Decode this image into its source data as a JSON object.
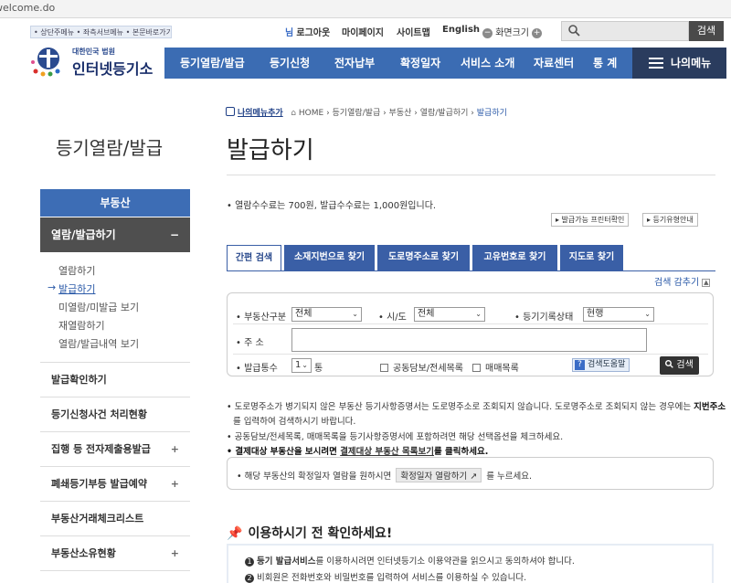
{
  "browser": {
    "title_fragment": "welcome.do"
  },
  "skip_links": "• 상단주메뉴 • 좌측서브메뉴 • 본문바로가기",
  "util": {
    "logout": "로그아웃",
    "mypage": "마이페이지",
    "sitemap": "사이트맵",
    "english": "English",
    "screen_size": "화면크기",
    "minus": "−",
    "plus": "+",
    "search_button": "검색"
  },
  "logo": {
    "sub": "대한민국 법원",
    "main": "인터넷등기소"
  },
  "gnb": [
    "등기열람/발급",
    "등기신청",
    "전자납부",
    "확정일자",
    "서비스 소개",
    "자료센터",
    "통 계"
  ],
  "my_menu": "나의메뉴",
  "sidebar": {
    "title": "등기열람/발급",
    "category": "부동산",
    "active": "열람/발급하기",
    "active_toggle": "−",
    "sub_items": [
      "열람하기",
      "발급하기",
      "미열람/미발급 보기",
      "재열람하기",
      "열람/발급내역 보기"
    ],
    "sub_active_marker": "→",
    "items": [
      {
        "label": "발급확인하기",
        "toggle": ""
      },
      {
        "label": "등기신청사건 처리현황",
        "toggle": ""
      },
      {
        "label": "집행 등 전자제출용발급",
        "toggle": "+"
      },
      {
        "label": "폐쇄등기부등 발급예약",
        "toggle": "+"
      },
      {
        "label": "부동산거래체크리스트",
        "toggle": ""
      },
      {
        "label": "부동산소유현황",
        "toggle": "+"
      }
    ]
  },
  "breadcrumb": {
    "add": "나의메뉴추가",
    "home": "HOME",
    "path": "› 등기열람/발급 › 부동산 › 열람/발급하기 ›",
    "current": "발급하기"
  },
  "page_title": "발급하기",
  "fee_note": "• 열람수수료는 700원, 발급수수료는 1,000원입니다.",
  "small_buttons": [
    "▸ 발급가능 프린터확인",
    "▸ 등기유형안내"
  ],
  "tabs": [
    "간편 검색",
    "소재지번으로 찾기",
    "도로명주소로 찾기",
    "고유번호로 찾기",
    "지도로 찾기"
  ],
  "collapse_search": "검색 감추기",
  "collapse_icon": "▲",
  "form": {
    "type_label": "• 부동산구분",
    "type_value": "전체",
    "city_label": "• 시/도",
    "city_value": "전체",
    "status_label": "• 등기기록상태",
    "status_value": "현행",
    "address_label": "• 주 소",
    "address_value": "",
    "copies_label": "• 발급통수",
    "copies_value": "1",
    "copies_unit": "통",
    "opt_joint": "공동담보/전세목록",
    "opt_sales": "매매목록",
    "help_q": "?",
    "help_label": "검색도움말",
    "search_label": "검색",
    "chevron": "⌄"
  },
  "notices": {
    "line1_a": "• 도로명주소가 병기되지 않은 부동산 등기사항증명서는 도로명주소로 조회되지 않습니다. 도로명주소로 조회되지 않는 경우에는 ",
    "line1_b": "지번주소",
    "line2": "를 입력하여 검색하시기 바랍니다.",
    "line3": "• 공동담보/전세목록, 매매목록을 등기사항증명서에 포함하려면 해당 선택옵션을 체크하세요.",
    "line4_a": "• 결제대상 부동산을 보시려면 ",
    "line4_link": "결제대상 부동산 목록보기",
    "line4_b": "를 클릭하세요."
  },
  "info_box": {
    "pre": "• 해당 부동산의 확정일자 열람을 원하시면",
    "button": "확정일자 열람하기 ↗",
    "post": "를 누르세요."
  },
  "check_section": {
    "title": "이용하시기 전 확인하세요!",
    "pin": "📌",
    "lines": [
      {
        "n": "1",
        "bold": "등기 발급서비스",
        "text": "를 이용하시려면 인터넷등기소 이용약관을 읽으시고 동의하셔야 합니다."
      },
      {
        "n": "2",
        "bold": "",
        "text": "비회원은 전화번호와 비밀번호를 입력하여 서비스를 이용하실 수 있습니다."
      }
    ]
  },
  "colors": {
    "gnb": "#3b6cb3",
    "mymenu": "#2a3c5e",
    "side_active": "#4f4f4f",
    "side_cat": "#3d6db5",
    "tab": "#3a5fa6"
  }
}
